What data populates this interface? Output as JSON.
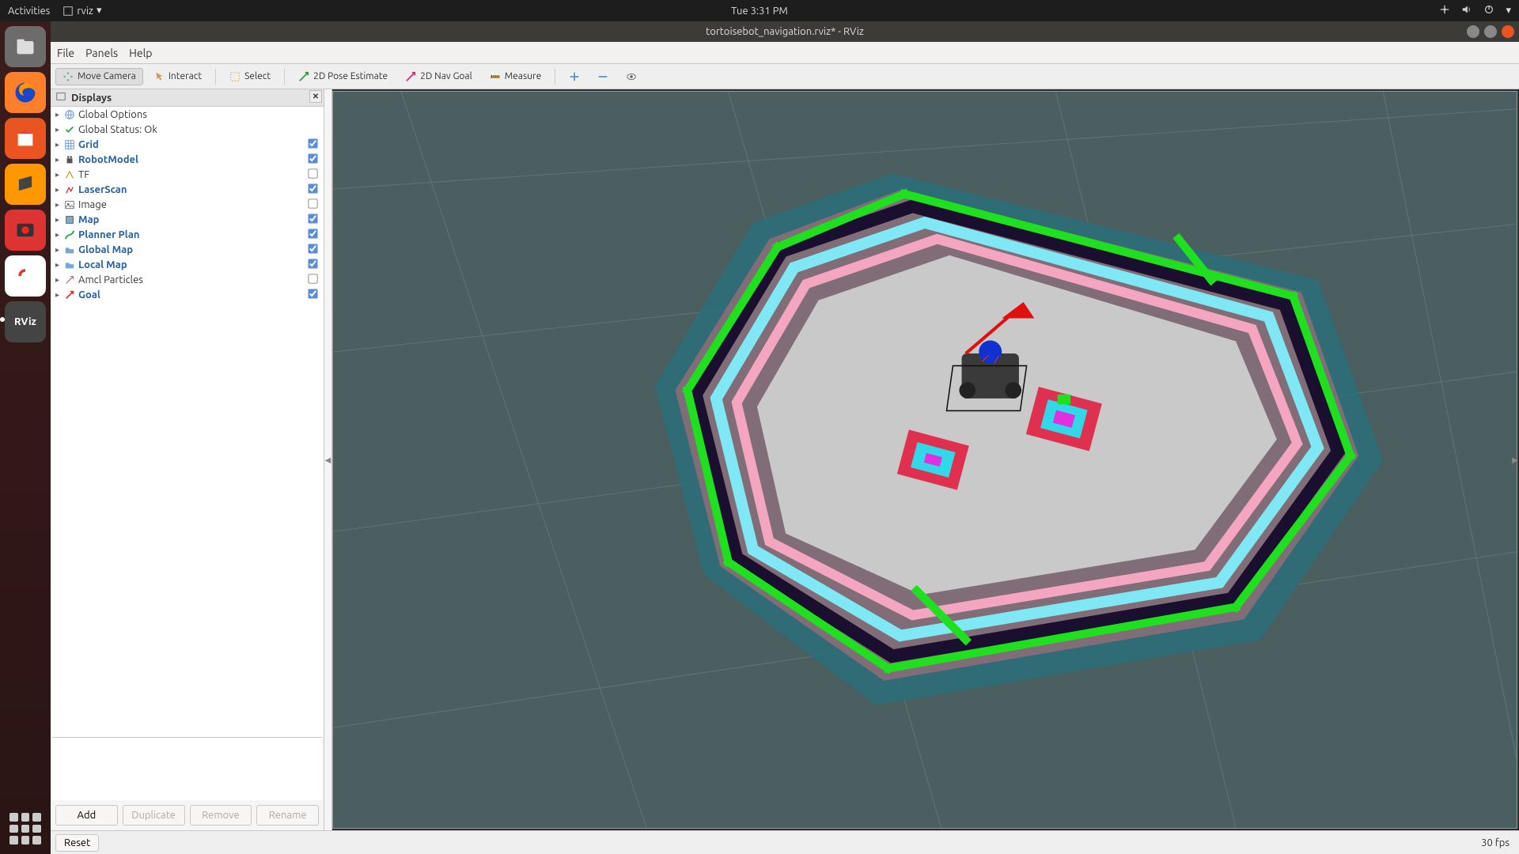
{
  "topbar": {
    "activities": "Activities",
    "appname": "rviz",
    "clock": "Tue  3:31 PM"
  },
  "launcher": {
    "rviz_label": "RViz"
  },
  "window": {
    "title": "tortoisebot_navigation.rviz* - RViz"
  },
  "menu": {
    "file": "File",
    "panels": "Panels",
    "help": "Help"
  },
  "toolbar": {
    "move_camera": "Move Camera",
    "interact": "Interact",
    "select": "Select",
    "pose_estimate": "2D Pose Estimate",
    "nav_goal": "2D Nav Goal",
    "measure": "Measure"
  },
  "displays": {
    "title": "Displays",
    "items": [
      {
        "label": "Global Options",
        "link": false,
        "check": null,
        "icon": "globe"
      },
      {
        "label": "Global Status: Ok",
        "link": false,
        "check": null,
        "icon": "check"
      },
      {
        "label": "Grid",
        "link": true,
        "check": true,
        "icon": "grid"
      },
      {
        "label": "RobotModel",
        "link": true,
        "check": true,
        "icon": "robot"
      },
      {
        "label": "TF",
        "link": false,
        "check": false,
        "icon": "tf"
      },
      {
        "label": "LaserScan",
        "link": true,
        "check": true,
        "icon": "laser"
      },
      {
        "label": "Image",
        "link": false,
        "check": false,
        "icon": "image"
      },
      {
        "label": "Map",
        "link": true,
        "check": true,
        "icon": "map"
      },
      {
        "label": "Planner Plan",
        "link": true,
        "check": true,
        "icon": "path"
      },
      {
        "label": "Global Map",
        "link": true,
        "check": true,
        "icon": "folder"
      },
      {
        "label": "Local Map",
        "link": true,
        "check": true,
        "icon": "folder"
      },
      {
        "label": "Amcl Particles",
        "link": false,
        "check": false,
        "icon": "particles"
      },
      {
        "label": "Goal",
        "link": true,
        "check": true,
        "icon": "goal"
      }
    ],
    "buttons": {
      "add": "Add",
      "duplicate": "Duplicate",
      "remove": "Remove",
      "rename": "Rename"
    }
  },
  "status": {
    "reset": "Reset",
    "fps": "30 fps"
  }
}
